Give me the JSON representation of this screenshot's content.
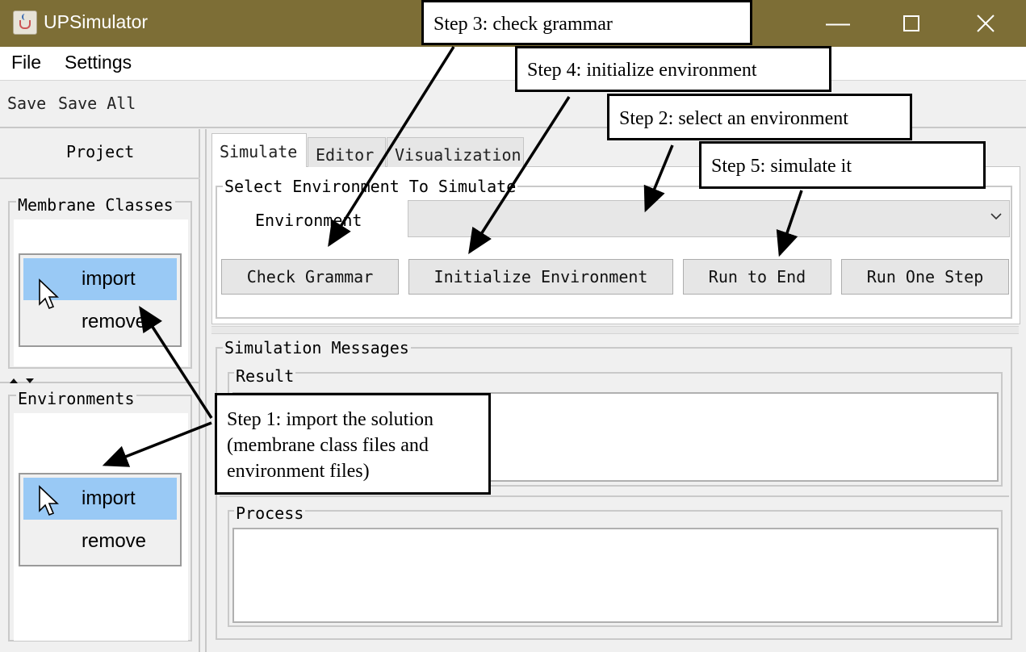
{
  "window": {
    "title": "UPSimulator",
    "controls": {
      "minimize": "—",
      "maximize": "☐",
      "close": "✕"
    }
  },
  "menubar": {
    "items": [
      "File",
      "Settings"
    ]
  },
  "toolbar": {
    "save": "Save",
    "save_all": "Save All"
  },
  "left_panel": {
    "project": "Project",
    "membrane_classes": {
      "title": "Membrane Classes",
      "menu": {
        "import": "import",
        "remove": "remove"
      }
    },
    "environments": {
      "title": "Environments",
      "menu": {
        "import": "import",
        "remove": "remove"
      }
    }
  },
  "tabs": [
    "Simulate",
    "Editor",
    "Visualization"
  ],
  "simulate": {
    "select_group": "Select Environment To Simulate",
    "environment_label": "Environment",
    "environment_value": "",
    "buttons": {
      "check": "Check Grammar",
      "init": "Initialize Environment",
      "run_end": "Run to End",
      "run_step": "Run One Step"
    },
    "messages_group": "Simulation Messages",
    "result_label": "Result",
    "process_label": "Process"
  },
  "annotations": {
    "step1": "Step 1: import the solution\n(membrane class files and\nenvironment files)",
    "step2": "Step 2: select an environment",
    "step3": "Step 3: check grammar",
    "step4": "Step 4: initialize environment",
    "step5": "Step 5: simulate it"
  },
  "colors": {
    "titlebar": "#7d6e36",
    "highlight": "#99c9f5",
    "window_bg": "#f0f0f0"
  }
}
